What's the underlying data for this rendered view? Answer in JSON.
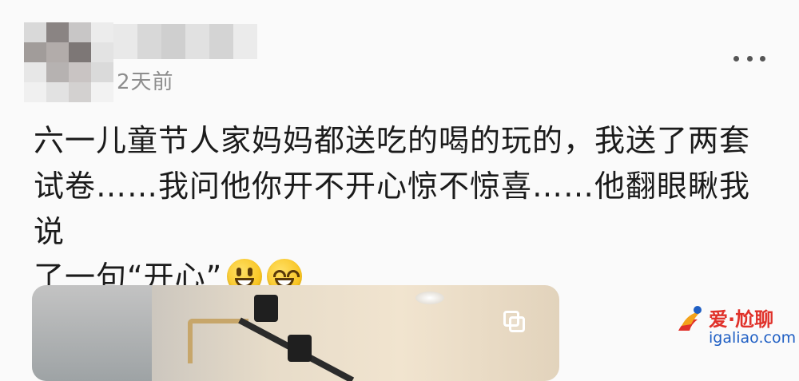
{
  "post": {
    "timestamp": "2天前",
    "lines": [
      "六一儿童节人家妈妈都送吃的喝的玩的，我送了两套",
      "试卷……我问他你开不开心惊不惊喜……他翻眼瞅我说",
      "了一句“开心”"
    ],
    "emojis": [
      "smiley-face-icon",
      "grinning-face-icon"
    ]
  },
  "watermark": {
    "brand": "爱·尬聊",
    "domain": "igaliao.com"
  },
  "colors": {
    "text": "#1b1b1b",
    "timestamp": "#8d8d8d",
    "brand_red": "#e0312a",
    "brand_blue": "#1f5fc4"
  }
}
